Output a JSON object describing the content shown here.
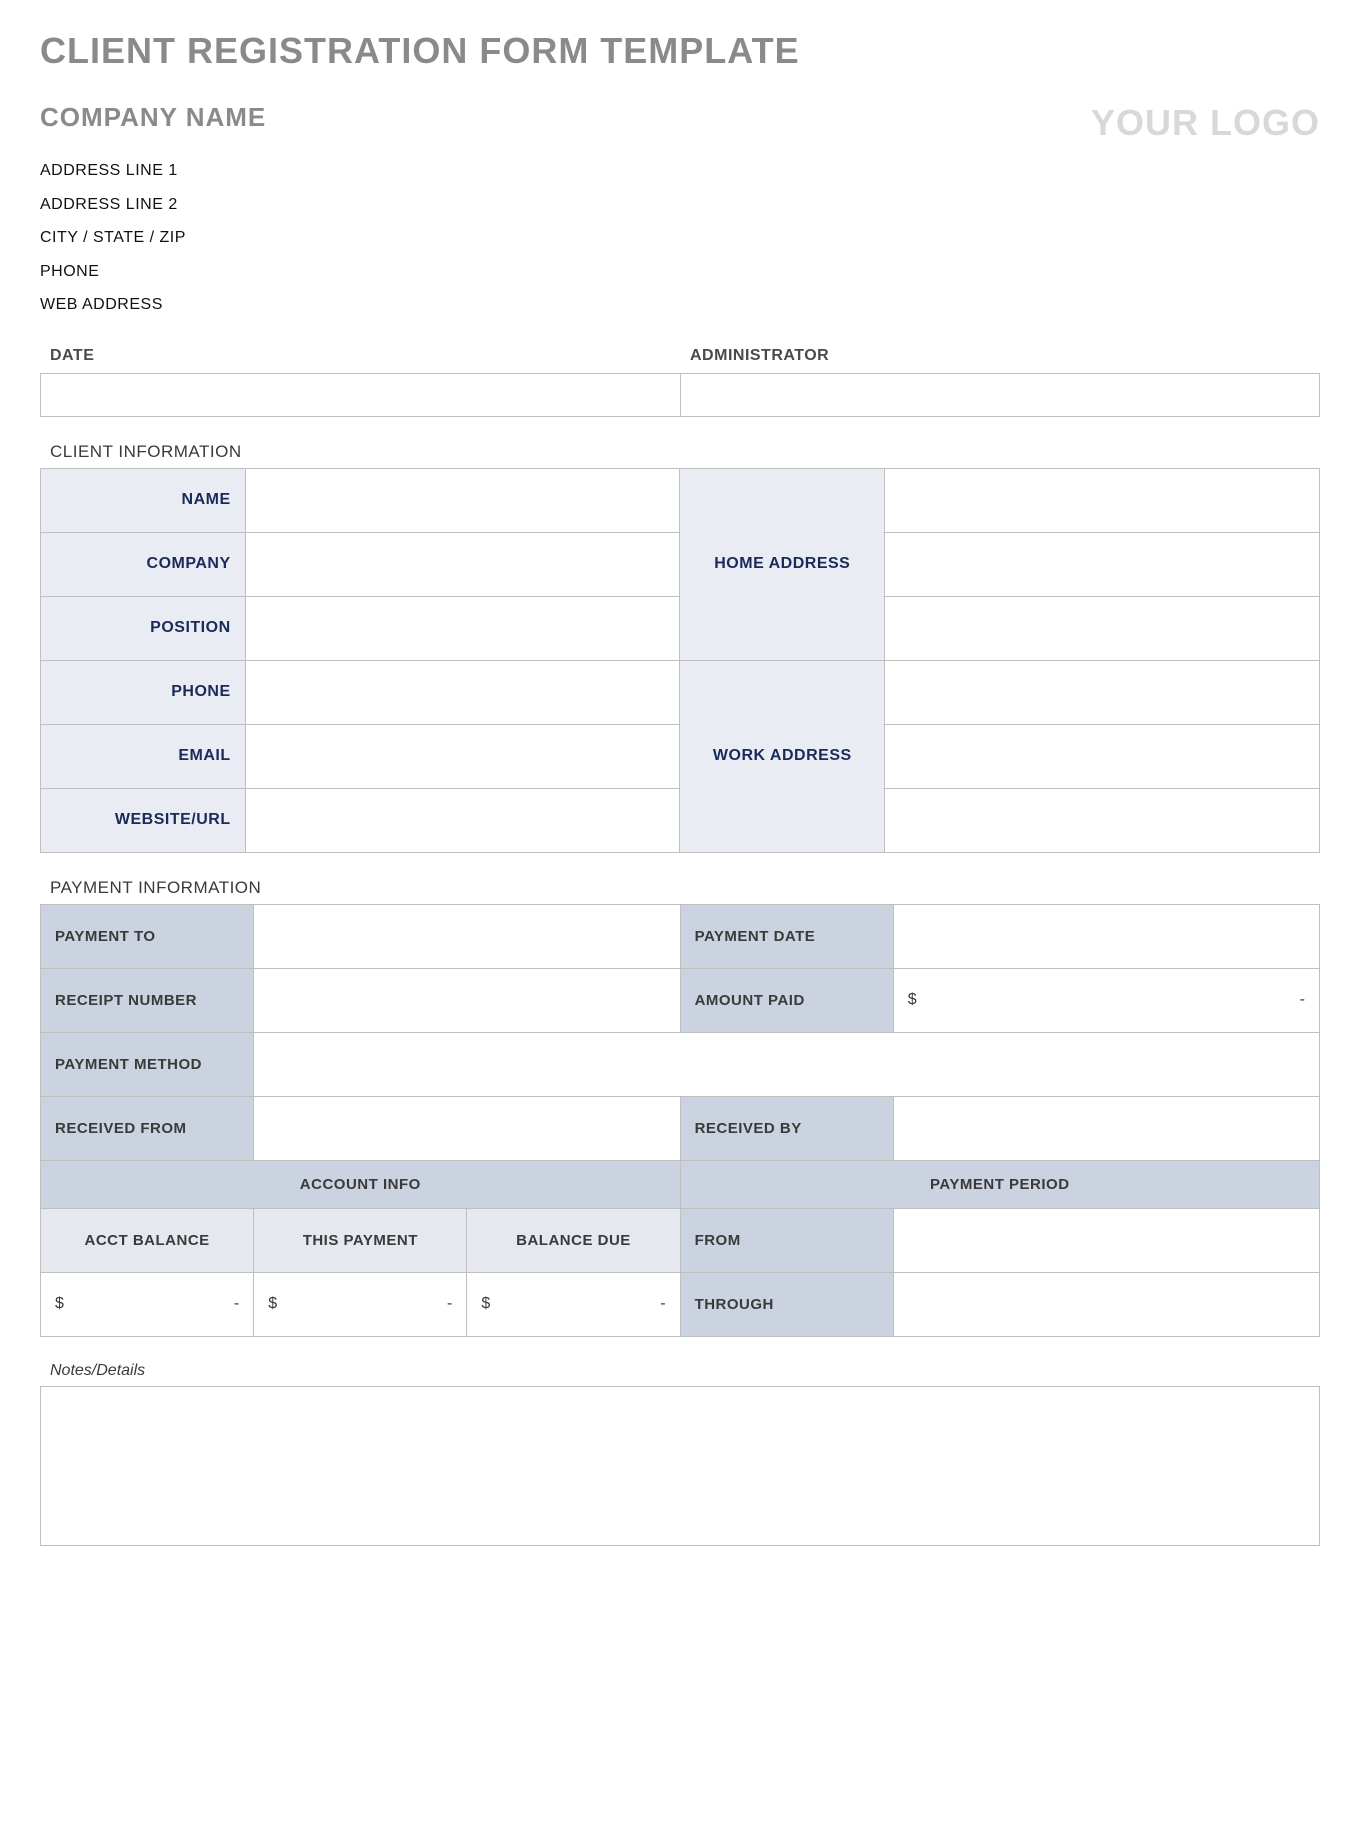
{
  "title": "CLIENT REGISTRATION FORM TEMPLATE",
  "company": {
    "name_label": "COMPANY NAME",
    "logo_text": "YOUR LOGO",
    "address_line_1": "ADDRESS LINE 1",
    "address_line_2": "ADDRESS LINE 2",
    "city_state_zip": "CITY / STATE / ZIP",
    "phone": "PHONE",
    "web": "WEB ADDRESS"
  },
  "header_fields": {
    "date_label": "DATE",
    "date_value": "",
    "admin_label": "ADMINISTRATOR",
    "admin_value": ""
  },
  "client_info": {
    "section_title": "CLIENT INFORMATION",
    "labels": {
      "name": "NAME",
      "company": "COMPANY",
      "position": "POSITION",
      "phone": "PHONE",
      "email": "EMAIL",
      "website": "WEBSITE/URL",
      "home_address": "HOME ADDRESS",
      "work_address": "WORK ADDRESS"
    },
    "values": {
      "name": "",
      "company": "",
      "position": "",
      "phone": "",
      "email": "",
      "website": "",
      "home_address_1": "",
      "home_address_2": "",
      "home_address_3": "",
      "work_address_1": "",
      "work_address_2": "",
      "work_address_3": ""
    }
  },
  "payment_info": {
    "section_title": "PAYMENT INFORMATION",
    "labels": {
      "payment_to": "PAYMENT TO",
      "receipt_number": "RECEIPT NUMBER",
      "payment_method": "PAYMENT METHOD",
      "received_from": "RECEIVED FROM",
      "payment_date": "PAYMENT DATE",
      "amount_paid": "AMOUNT PAID",
      "received_by": "RECEIVED BY",
      "account_info": "ACCOUNT INFO",
      "payment_period": "PAYMENT PERIOD",
      "acct_balance": "ACCT BALANCE",
      "this_payment": "THIS PAYMENT",
      "balance_due": "BALANCE DUE",
      "from": "FROM",
      "through": "THROUGH"
    },
    "values": {
      "payment_to": "",
      "receipt_number": "",
      "payment_method": "",
      "received_from": "",
      "payment_date": "",
      "amount_paid_currency": "$",
      "amount_paid_value": "-",
      "received_by": "",
      "acct_balance_currency": "$",
      "acct_balance_value": "-",
      "this_payment_currency": "$",
      "this_payment_value": "-",
      "balance_due_currency": "$",
      "balance_due_value": "-",
      "from": "",
      "through": ""
    }
  },
  "notes": {
    "label": "Notes/Details",
    "value": ""
  }
}
